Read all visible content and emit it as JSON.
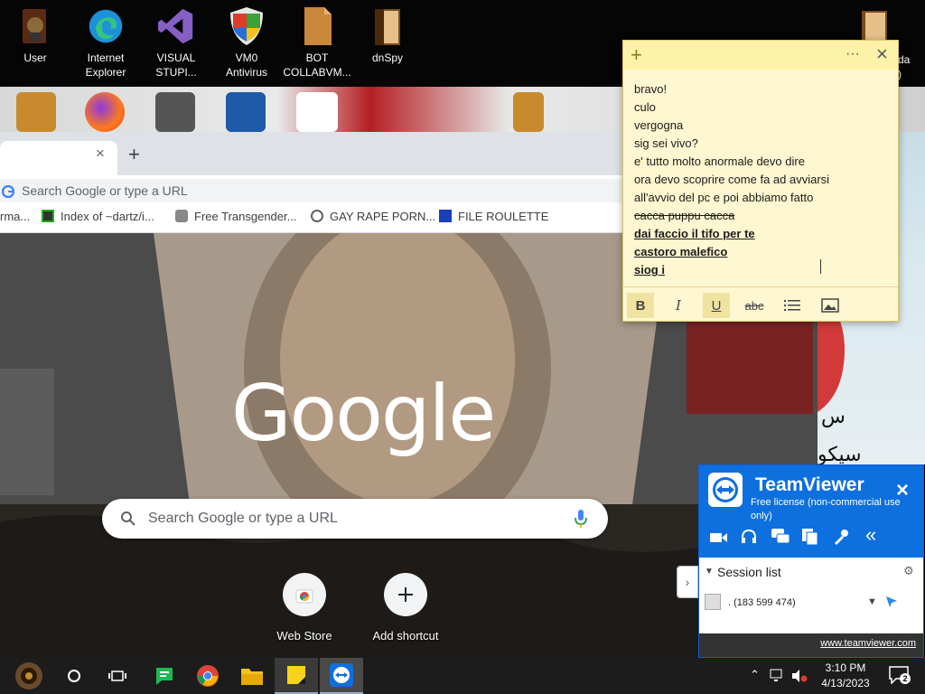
{
  "desktop": {
    "icons": [
      {
        "label": "User",
        "icon": "user-folder-icon"
      },
      {
        "label": "Internet Explorer",
        "icon": "edge-icon"
      },
      {
        "label": "VISUAL STUPI...",
        "icon": "visual-studio-icon"
      },
      {
        "label": "VM0 Antivirus",
        "icon": "shield-icon"
      },
      {
        "label": "BOT COLLABVM...",
        "icon": "document-icon"
      },
      {
        "label": "dnSpy",
        "icon": "folder-icon"
      }
    ],
    "partial_icon_label": "da\n)"
  },
  "browser": {
    "tab_close": "×",
    "new_tab": "+",
    "omnibox_placeholder": "Search Google or type a URL",
    "bookmarks": [
      {
        "label": "rma...",
        "icon": "bookmark-icon"
      },
      {
        "label": "Index of ~dartz/i...",
        "icon": "qr-icon"
      },
      {
        "label": "Free Transgender...",
        "icon": "site-icon"
      },
      {
        "label": "GAY RAPE PORN...",
        "icon": "globe-icon"
      },
      {
        "label": "FILE ROULETTE",
        "icon": "mft-icon"
      }
    ],
    "logo": "Google",
    "search_placeholder": "Search Google or type a URL",
    "shortcuts": [
      {
        "label": "Web Store",
        "icon": "chrome-webstore-icon"
      },
      {
        "label": "Add shortcut",
        "icon": "plus-icon"
      }
    ]
  },
  "sticky": {
    "add": "+",
    "menu": "···",
    "close": "×",
    "lines": [
      {
        "text": "bravo!",
        "style": "normal"
      },
      {
        "text": "culo",
        "style": "normal"
      },
      {
        "text": "vergogna",
        "style": "normal"
      },
      {
        "text": "sig sei vivo?",
        "style": "normal"
      },
      {
        "text": "e' tutto molto anormale devo dire",
        "style": "normal"
      },
      {
        "text": "ora devo scoprire come fa ad avviarsi",
        "style": "normal"
      },
      {
        "text": "all'avvio del pc e poi abbiamo fatto",
        "style": "normal"
      },
      {
        "text": "cacca puppu cacca",
        "style": "strike"
      },
      {
        "text": "dai faccio il tifo per te",
        "style": "bold-underline"
      },
      {
        "text": "castoro malefico",
        "style": "bold-underline"
      },
      {
        "text": "siog i",
        "style": "bold-underline"
      }
    ],
    "toolbar": {
      "bold": "B",
      "italic": "I",
      "underline": "U",
      "strike": "abc"
    }
  },
  "teamviewer": {
    "title": "TeamViewer",
    "subtitle": "Free license (non-commercial use only)",
    "close": "×",
    "section": "Session list",
    "session": ". (183 599 474)",
    "link": "www.teamviewer.com",
    "collapse": "«",
    "expand": "›"
  },
  "taskbar": {
    "time": "3:10 PM",
    "date": "4/13/2023",
    "notifications": "2"
  },
  "colors": {
    "teamviewer_blue": "#0e6fde",
    "sticky_yellow": "#fff7d1",
    "taskbar": "#1c1c1c"
  }
}
